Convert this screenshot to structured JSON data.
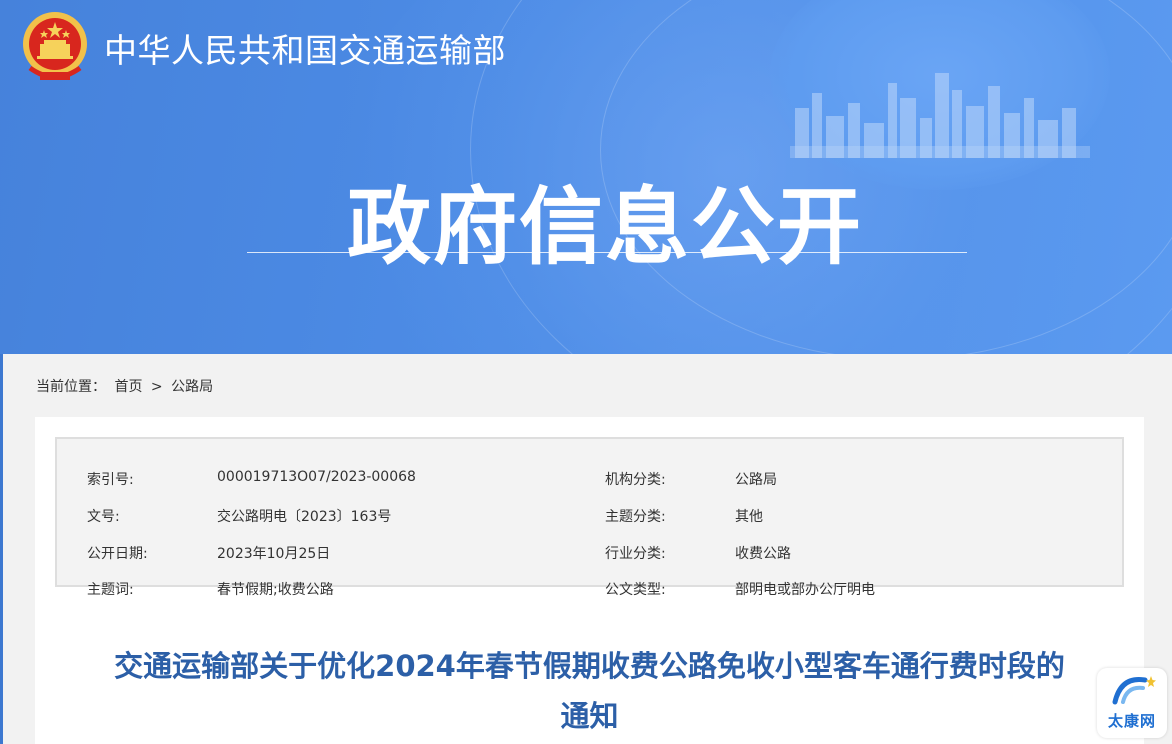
{
  "header": {
    "site_title": "中华人民共和国交通运输部",
    "hero_title": "政府信息公开",
    "emblem_icon": "national-emblem-icon"
  },
  "breadcrumb": {
    "label": "当前位置：",
    "items": [
      "首页",
      "公路局"
    ],
    "separator": ">"
  },
  "meta": {
    "rows": [
      {
        "k1": "索引号:",
        "v1": "000019713O07/2023-00068",
        "k2": "机构分类:",
        "v2": "公路局"
      },
      {
        "k1": "文号:",
        "v1": "交公路明电〔2023〕163号",
        "k2": "主题分类:",
        "v2": "其他"
      },
      {
        "k1": "公开日期:",
        "v1": "2023年10月25日",
        "k2": "行业分类:",
        "v2": "收费公路"
      },
      {
        "k1": "主题词:",
        "v1": "春节假期;收费公路",
        "k2": "公文类型:",
        "v2": "部明电或部办公厅明电"
      }
    ]
  },
  "document": {
    "title_line1": "交通运输部关于优化2024年春节假期收费公路免收小型客车通行费时段的",
    "title_line2": "通知"
  },
  "watermark": {
    "text": "太康网"
  },
  "colors": {
    "banner": "#4d8ce6",
    "title_blue": "#2c5fa7",
    "meta_bg": "#f3f3f3",
    "page_bg": "#f2f2f2"
  }
}
